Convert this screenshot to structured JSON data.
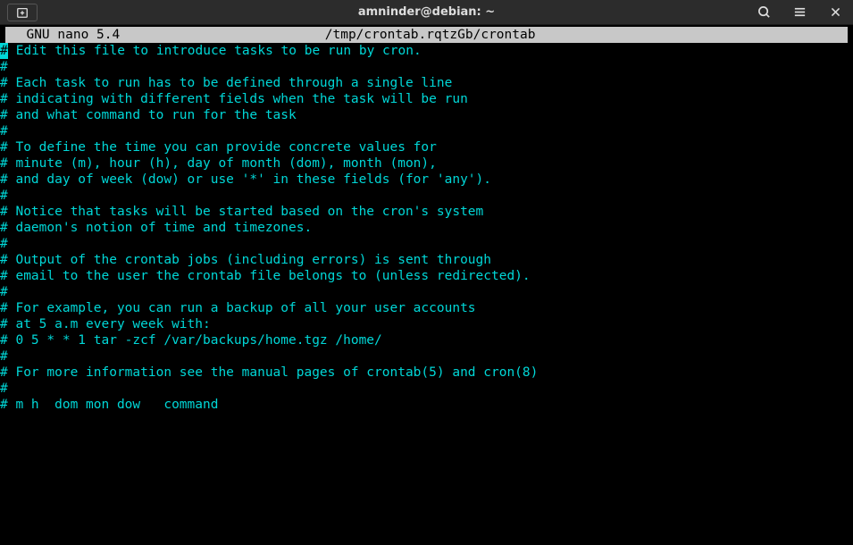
{
  "titlebar": {
    "title": "amninder@debian: ~"
  },
  "nano": {
    "app": "  GNU nano 5.4",
    "filepath": "/tmp/crontab.rqtzGb/crontab"
  },
  "lines": [
    "Edit this file to introduce tasks to be run by cron.",
    "",
    "Each task to run has to be defined through a single line",
    "indicating with different fields when the task will be run",
    "and what command to run for the task",
    "",
    "To define the time you can provide concrete values for",
    "minute (m), hour (h), day of month (dom), month (mon),",
    "and day of week (dow) or use '*' in these fields (for 'any').",
    "",
    "Notice that tasks will be started based on the cron's system",
    "daemon's notion of time and timezones.",
    "",
    "Output of the crontab jobs (including errors) is sent through",
    "email to the user the crontab file belongs to (unless redirected).",
    "",
    "For example, you can run a backup of all your user accounts",
    "at 5 a.m every week with:",
    "0 5 * * 1 tar -zcf /var/backups/home.tgz /home/",
    "",
    "For more information see the manual pages of crontab(5) and cron(8)",
    "",
    "m h  dom mon dow   command"
  ]
}
